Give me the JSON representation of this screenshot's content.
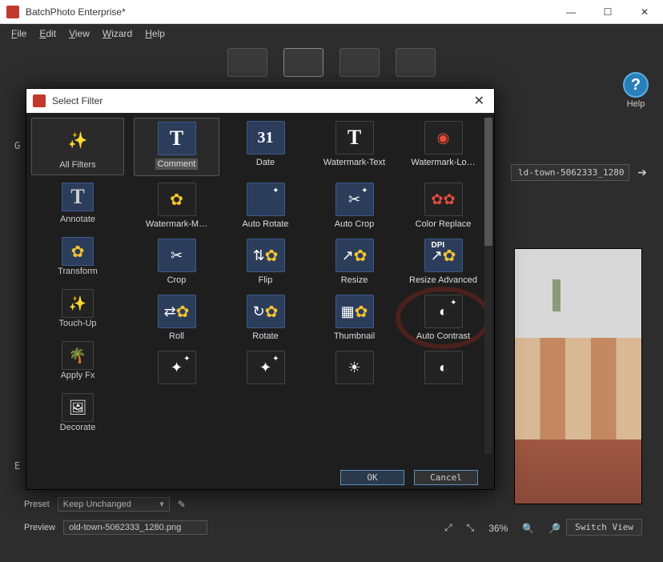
{
  "window": {
    "title": "BatchPhoto Enterprise*"
  },
  "menu": {
    "file": "File",
    "edit": "Edit",
    "view": "View",
    "wizard": "Wizard",
    "help": "Help"
  },
  "helpBtn": {
    "label": "Help",
    "glyph": "?"
  },
  "bgLabels": {
    "g": "G",
    "e": "E"
  },
  "breadcrumb": {
    "text": "ld-town-5062333_1280",
    "arrow": "➔"
  },
  "preset": {
    "label": "Preset",
    "value": "Keep Unchanged"
  },
  "previewField": {
    "label": "Preview",
    "value": "old-town-5062333_1280.png"
  },
  "viewControls": {
    "zoom": "36%",
    "switch": "Switch View"
  },
  "dialog": {
    "title": "Select Filter",
    "sidebar": [
      {
        "label": "All Filters",
        "selected": true
      },
      {
        "label": "Annotate"
      },
      {
        "label": "Transform"
      },
      {
        "label": "Touch-Up"
      },
      {
        "label": "Apply Fx"
      },
      {
        "label": "Decorate"
      }
    ],
    "filters": [
      {
        "label": "Comment",
        "selected": true
      },
      {
        "label": "Date"
      },
      {
        "label": "Watermark-Text"
      },
      {
        "label": "Watermark-Lo…"
      },
      {
        "label": "Watermark-M…"
      },
      {
        "label": "Auto Rotate"
      },
      {
        "label": "Auto Crop"
      },
      {
        "label": "Color Replace"
      },
      {
        "label": "Crop"
      },
      {
        "label": "Flip"
      },
      {
        "label": "Resize"
      },
      {
        "label": "Resize Advanced"
      },
      {
        "label": "Roll"
      },
      {
        "label": "Rotate"
      },
      {
        "label": "Thumbnail"
      },
      {
        "label": "Auto Contrast",
        "highlight": true
      }
    ],
    "ok": "OK",
    "cancel": "Cancel"
  }
}
